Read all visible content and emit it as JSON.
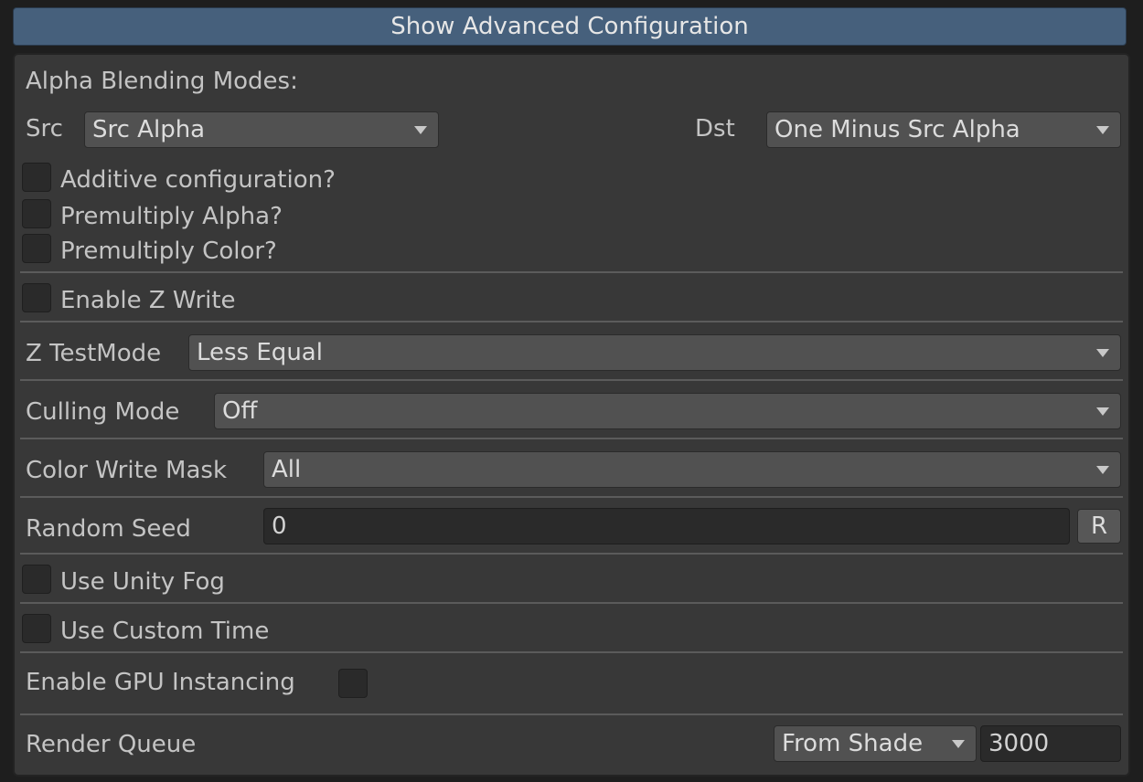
{
  "header": {
    "button_label": "Show Advanced Configuration"
  },
  "alpha_blending": {
    "title": "Alpha Blending Modes:",
    "src_label": "Src",
    "src_value": "Src Alpha",
    "dst_label": "Dst",
    "dst_value": "One Minus Src Alpha",
    "additive_label": "Additive configuration?",
    "premultiply_alpha_label": "Premultiply Alpha?",
    "premultiply_color_label": "Premultiply Color?"
  },
  "z_write": {
    "label": "Enable Z Write"
  },
  "z_test": {
    "label": "Z TestMode",
    "value": "Less Equal"
  },
  "culling": {
    "label": "Culling Mode",
    "value": "Off"
  },
  "color_mask": {
    "label": "Color Write Mask",
    "value": "All"
  },
  "random_seed": {
    "label": "Random Seed",
    "value": "0",
    "reset_label": "R"
  },
  "fog": {
    "label": "Use Unity Fog"
  },
  "custom_time": {
    "label": "Use Custom Time"
  },
  "gpu_instancing": {
    "label": "Enable GPU Instancing"
  },
  "render_queue": {
    "label": "Render Queue",
    "mode": "From Shade",
    "value": "3000"
  }
}
